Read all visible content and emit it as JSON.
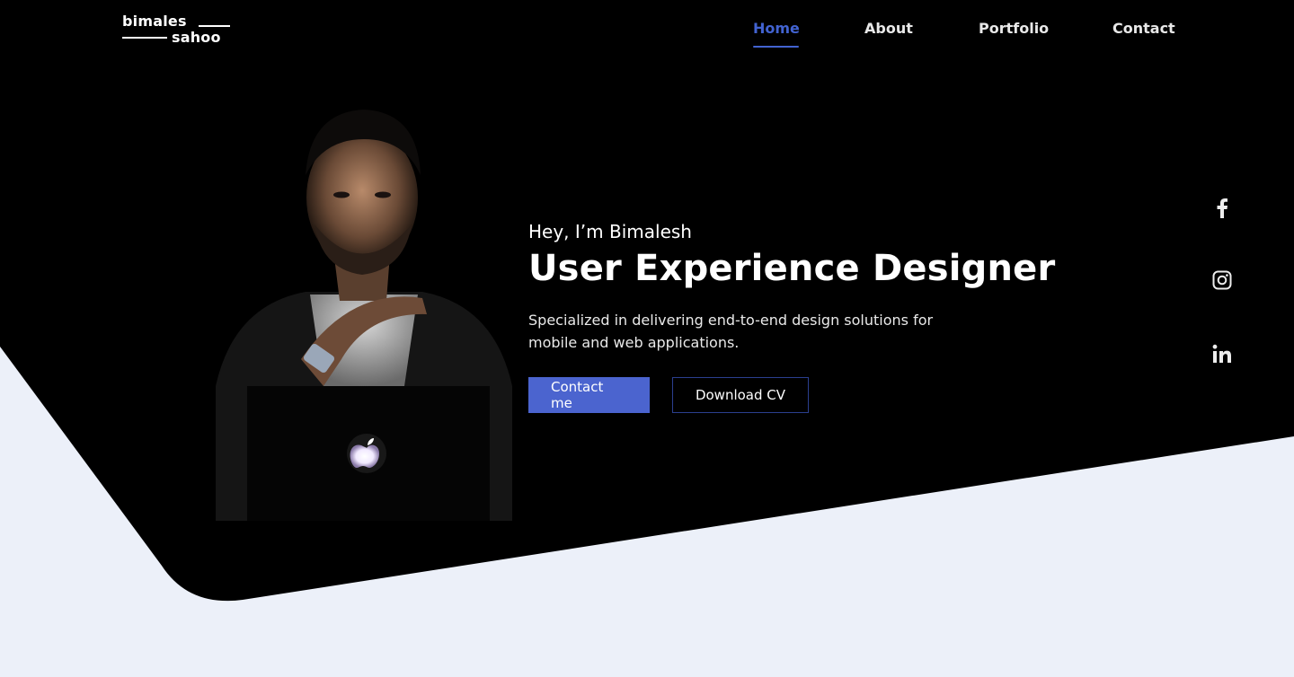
{
  "brand": {
    "logo_line1": "bimales",
    "logo_line2": "sahoo"
  },
  "nav": {
    "items": [
      {
        "label": "Home",
        "active": true
      },
      {
        "label": "About",
        "active": false
      },
      {
        "label": "Portfolio",
        "active": false
      },
      {
        "label": "Contact",
        "active": false
      }
    ]
  },
  "hero": {
    "greeting": "Hey, I’m Bimalesh",
    "headline": "User Experience Designer",
    "tagline": "Specialized in delivering end-to-end design solutions for mobile and web applications.",
    "primary_button": "Contact me",
    "secondary_button": "Download CV"
  },
  "social": [
    {
      "icon": "facebook-icon"
    },
    {
      "icon": "instagram-icon"
    },
    {
      "icon": "linkedin-icon"
    }
  ],
  "colors": {
    "accent": "#4263D1",
    "button_primary": "#4B64CF",
    "hero_bg": "#000000",
    "page_bg": "#ECF0F9"
  }
}
